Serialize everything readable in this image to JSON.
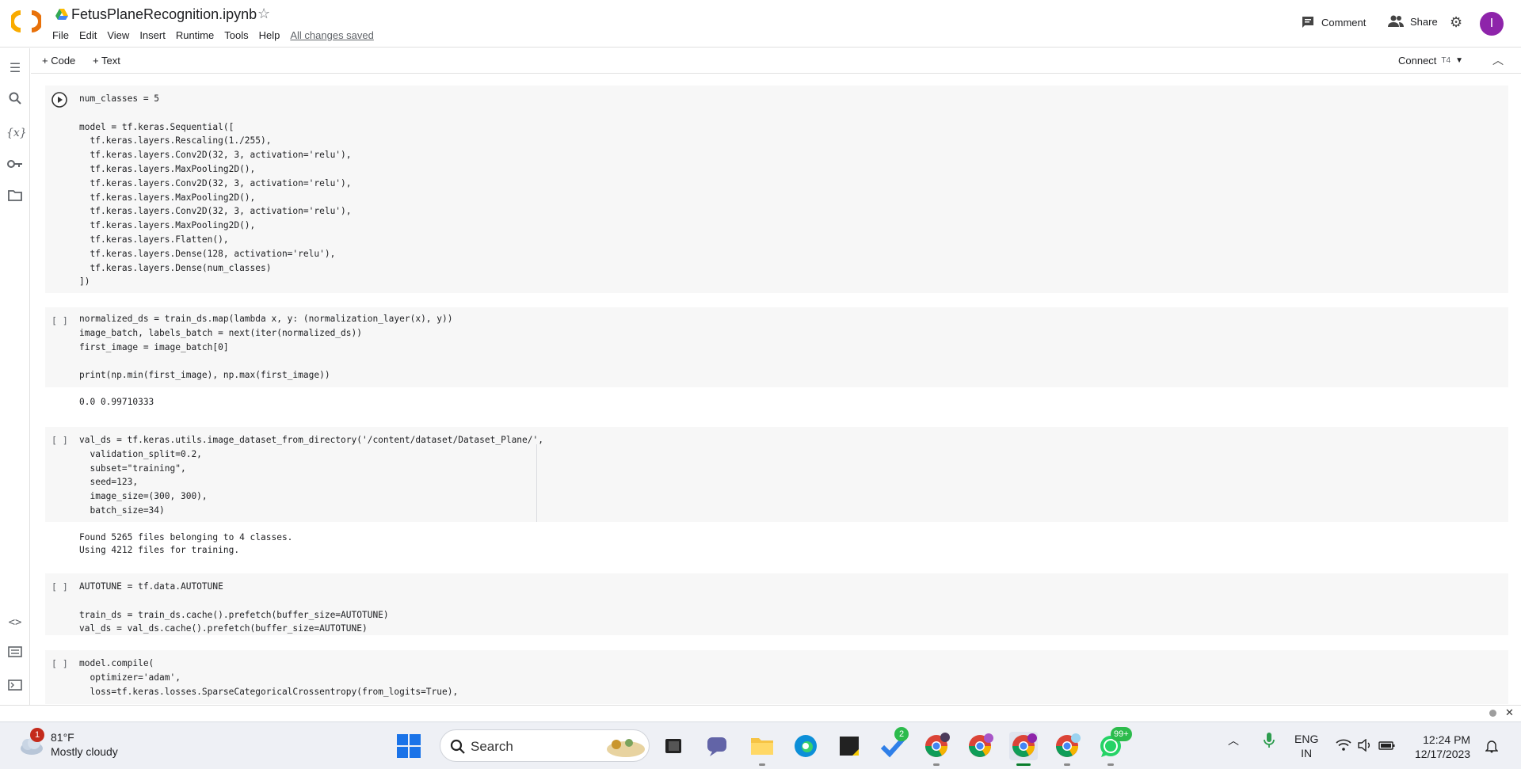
{
  "header": {
    "title": "FetusPlaneRecognition.ipynb",
    "menu": [
      "File",
      "Edit",
      "View",
      "Insert",
      "Runtime",
      "Tools",
      "Help"
    ],
    "saved_status": "All changes saved",
    "comment_label": "Comment",
    "share_label": "Share",
    "avatar_letter": "I"
  },
  "toolbar": {
    "add_code": "+ Code",
    "add_text": "+ Text",
    "connect_label": "Connect",
    "runtime_label": "T4"
  },
  "cells": {
    "c1": {
      "lines": [
        "num_classes = 5",
        "",
        "model = tf.keras.Sequential([",
        "  tf.keras.layers.Rescaling(1./255),",
        "  tf.keras.layers.Conv2D(32, 3, activation='relu'),",
        "  tf.keras.layers.MaxPooling2D(),",
        "  tf.keras.layers.Conv2D(32, 3, activation='relu'),",
        "  tf.keras.layers.MaxPooling2D(),",
        "  tf.keras.layers.Conv2D(32, 3, activation='relu'),",
        "  tf.keras.layers.MaxPooling2D(),",
        "  tf.keras.layers.Flatten(),",
        "  tf.keras.layers.Dense(128, activation='relu'),",
        "  tf.keras.layers.Dense(num_classes)",
        "])"
      ]
    },
    "c2": {
      "bracket": "[ ]",
      "lines": [
        "normalized_ds = train_ds.map(lambda x, y: (normalization_layer(x), y))",
        "image_batch, labels_batch = next(iter(normalized_ds))",
        "first_image = image_batch[0]",
        "",
        "print(np.min(first_image), np.max(first_image))"
      ],
      "output": "0.0 0.99710333"
    },
    "c3": {
      "bracket": "[ ]",
      "lines": [
        "val_ds = tf.keras.utils.image_dataset_from_directory('/content/dataset/Dataset_Plane/',",
        "  validation_split=0.2,",
        "  subset=\"training\",",
        "  seed=123,",
        "  image_size=(300, 300),",
        "  batch_size=34)"
      ],
      "output": [
        "Found 5265 files belonging to 4 classes.",
        "Using 4212 files for training."
      ]
    },
    "c4": {
      "bracket": "[ ]",
      "lines": [
        "AUTOTUNE = tf.data.AUTOTUNE",
        "",
        "train_ds = train_ds.cache().prefetch(buffer_size=AUTOTUNE)",
        "val_ds = val_ds.cache().prefetch(buffer_size=AUTOTUNE)"
      ]
    },
    "c5": {
      "bracket": "[ ]",
      "lines": [
        "model.compile(",
        "  optimizer='adam',",
        "  loss=tf.keras.losses.SparseCategoricalCrossentropy(from_logits=True),"
      ]
    }
  },
  "taskbar": {
    "weather_temp": "81°F",
    "weather_desc": "Mostly cloudy",
    "weather_badge": "1",
    "search_label": "Search",
    "todo_badge": "2",
    "whatsapp_badge": "99+",
    "lang_top": "ENG",
    "lang_bottom": "IN",
    "time": "12:24 PM",
    "date": "12/17/2023"
  },
  "colors": {
    "accent_orange": "#f9ab00",
    "avatar": "#8e24aa",
    "keyword": "#3a44a3",
    "string": "#a31515",
    "number": "#097a4b"
  }
}
